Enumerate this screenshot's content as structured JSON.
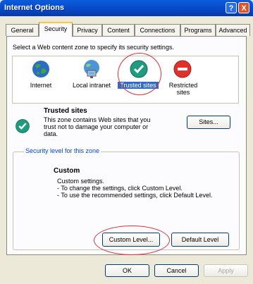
{
  "window": {
    "title": "Internet Options",
    "help_glyph": "?",
    "close_glyph": "X"
  },
  "tabs": [
    {
      "label": "General"
    },
    {
      "label": "Security"
    },
    {
      "label": "Privacy"
    },
    {
      "label": "Content"
    },
    {
      "label": "Connections"
    },
    {
      "label": "Programs"
    },
    {
      "label": "Advanced"
    }
  ],
  "security": {
    "instruction": "Select a Web content zone to specify its security settings.",
    "zones": [
      {
        "label": "Internet",
        "icon": "globe-icon"
      },
      {
        "label": "Local intranet",
        "icon": "network-computer-icon"
      },
      {
        "label": "Trusted sites",
        "icon": "check-icon"
      },
      {
        "label": "Restricted sites",
        "icon": "no-entry-icon"
      }
    ],
    "selected_zone": "Trusted sites",
    "zone_title": "Trusted sites",
    "zone_description": "This zone contains Web sites that you trust not to damage your computer or data.",
    "sites_button": "Sites...",
    "level_group_label": "Security level for this zone",
    "level_title": "Custom",
    "level_lines": [
      "Custom settings.",
      "- To change the settings, click Custom Level.",
      "- To use the recommended settings, click Default Level."
    ],
    "custom_level_button": "Custom Level...",
    "default_level_button": "Default Level"
  },
  "footer": {
    "ok": "OK",
    "cancel": "Cancel",
    "apply": "Apply"
  },
  "colors": {
    "title_bar": "#0747c6",
    "accent_tab": "#ffc83c",
    "highlight": "#d8323a",
    "group_label": "#0046d5"
  }
}
